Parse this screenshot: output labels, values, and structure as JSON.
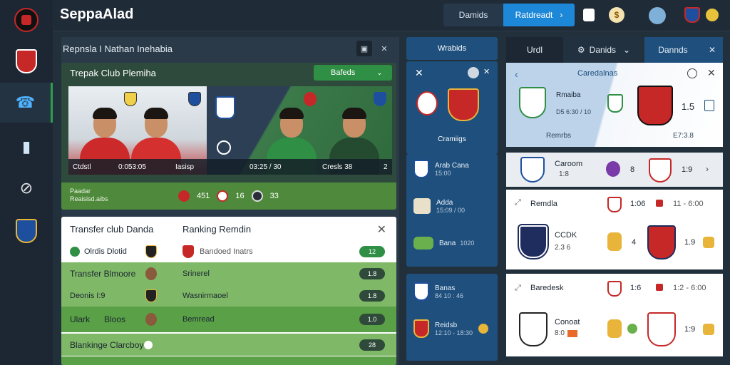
{
  "app": {
    "title": "SeppaAlad"
  },
  "rail": {
    "items": [
      {
        "name": "club-crest-red",
        "color": "#c62828"
      },
      {
        "name": "club-crest-red-2",
        "color": "#c62828"
      },
      {
        "name": "phone-icon"
      },
      {
        "name": "stats-icon"
      },
      {
        "name": "slash-icon"
      },
      {
        "name": "club-crest-blue",
        "color": "#1e4f9e"
      }
    ]
  },
  "topbar": {
    "segment_a": "Damids",
    "segment_b": "Ratdreadt",
    "segment_b_arrow": "›"
  },
  "main": {
    "title": "Repnsla I Nathan Inehabia",
    "feature": {
      "title": "Trepak Club Plemiha",
      "tag": "Bafeds",
      "tile_left_bar": [
        "Ctdstl",
        "0:053:05",
        "Iasisp"
      ],
      "tile_right_bar": [
        "03:25 / 30",
        "Cresls 38",
        "2"
      ],
      "foot_team_line1": "Paadar",
      "foot_team_line2": "Reaisisd.aibs",
      "foot_scores": [
        "451",
        "16",
        "33"
      ]
    },
    "transfer": {
      "head_left": "Transfer club Danda",
      "head_right": "Ranking Remdin",
      "rows": [
        {
          "left": "Olrdis Dlotid",
          "right": "Bandoed Inatrs",
          "pill": "12",
          "bg": "#ffffff"
        },
        {
          "left": "Transfer Blmoore",
          "right": "Srinerel",
          "pill": "1.8",
          "bg": "#7fb866"
        },
        {
          "left": "Deonis I:9",
          "right": "Wasnirmaoel",
          "pill": "1.8",
          "bg": "#7fb866"
        },
        {
          "left": "Ulark      Bloos",
          "right": "Bemread",
          "pill": "1.0",
          "bg": "#5aa046"
        },
        {
          "left": "Blankinge Clarcboy",
          "right": "",
          "pill": "28",
          "bg": "#7fb866"
        }
      ]
    }
  },
  "mid": {
    "header": "Wrabids",
    "block1_label": "Cramiigs",
    "items": [
      {
        "title": "Arab Cana",
        "sub": "15:00"
      },
      {
        "title": "Adda",
        "sub": "15:09 / 00"
      },
      {
        "title": "Bana",
        "sub": "1020"
      }
    ],
    "items2": [
      {
        "title": "Banas",
        "sub": "84 10 : 46"
      },
      {
        "title": "Reidsb",
        "sub": "12:10 - 18:30"
      }
    ]
  },
  "right": {
    "tabs": [
      "Urdl",
      "Danids",
      "Dannds"
    ],
    "banner": {
      "title": "Caredalnas",
      "team": "Rmaiba",
      "sub": "D5 6:30 / 10",
      "caption": "Remrbs",
      "odds": "1.5",
      "time": "E7:3.8"
    },
    "rows": [
      {
        "team": "Caroom",
        "sub": "1:8",
        "a": "8",
        "b": "1:9"
      },
      {
        "team": "Remdla",
        "a": "1:06",
        "b": "11 - 6:00"
      },
      {
        "team": "CCDK",
        "sub": "2.3 6",
        "a": "4",
        "b": "1.9"
      },
      {
        "team": "Baredesk",
        "a": "1:6",
        "b": "1:2 - 6:00"
      },
      {
        "team": "Conoat",
        "sub": "8:0",
        "a": "",
        "b": "1:9"
      }
    ]
  },
  "colors": {
    "accent": "#1e88d8",
    "green": "#2f8f45",
    "navy": "#1e4f7d"
  }
}
